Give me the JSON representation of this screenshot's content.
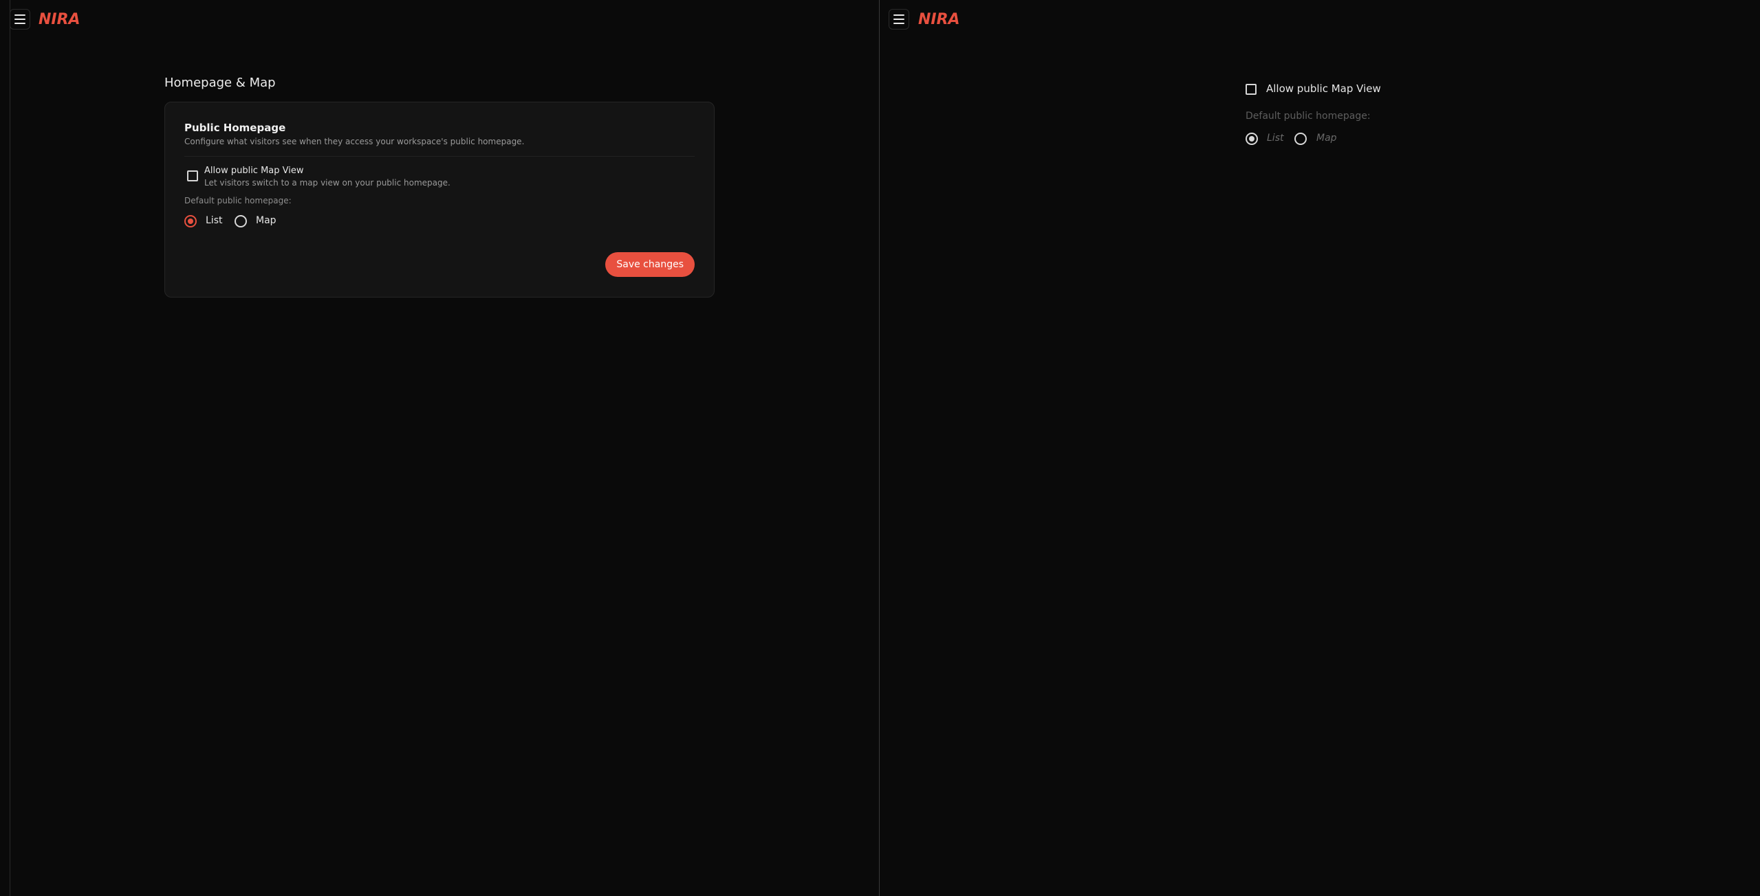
{
  "brand": {
    "logo_text": "NIRA",
    "accent": "#e8503f"
  },
  "left": {
    "page_title": "Homepage & Map",
    "card": {
      "title": "Public Homepage",
      "description": "Configure what visitors see when they access your workspace's public homepage.",
      "allow_map": {
        "label": "Allow public Map View",
        "help": "Let visitors switch to a map view on your public homepage.",
        "checked": false
      },
      "default_label": "Default public homepage:",
      "options": [
        {
          "label": "List",
          "selected": true
        },
        {
          "label": "Map",
          "selected": false
        }
      ],
      "save_label": "Save changes"
    }
  },
  "right": {
    "allow_map": {
      "label": "Allow public Map View",
      "checked": false
    },
    "default_label": "Default public homepage:",
    "options": [
      {
        "label": "List",
        "selected": true
      },
      {
        "label": "Map",
        "selected": false
      }
    ]
  }
}
